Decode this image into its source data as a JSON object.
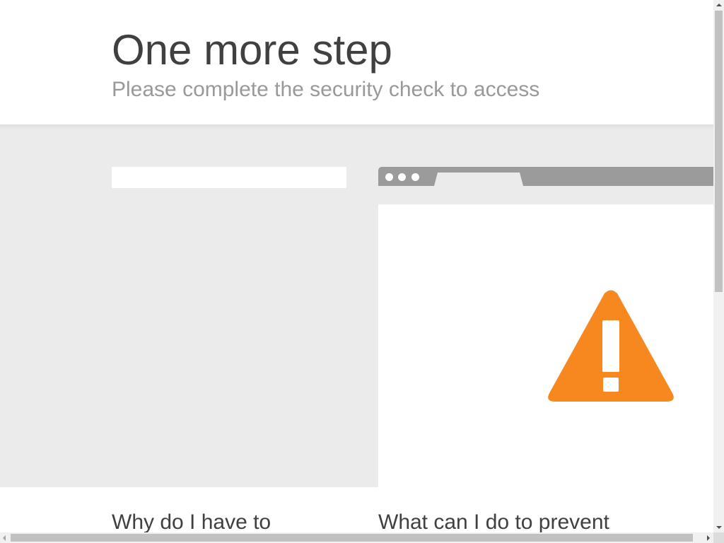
{
  "header": {
    "title": "One more step",
    "subtitle": "Please complete the security check to access"
  },
  "illustration": {
    "icon": "warning-icon",
    "icon_color": "#f6881f",
    "bar_color": "#9b9b9b"
  },
  "sections": {
    "why_heading": "Why do I have to",
    "prevent_heading": "What can I do to prevent"
  }
}
